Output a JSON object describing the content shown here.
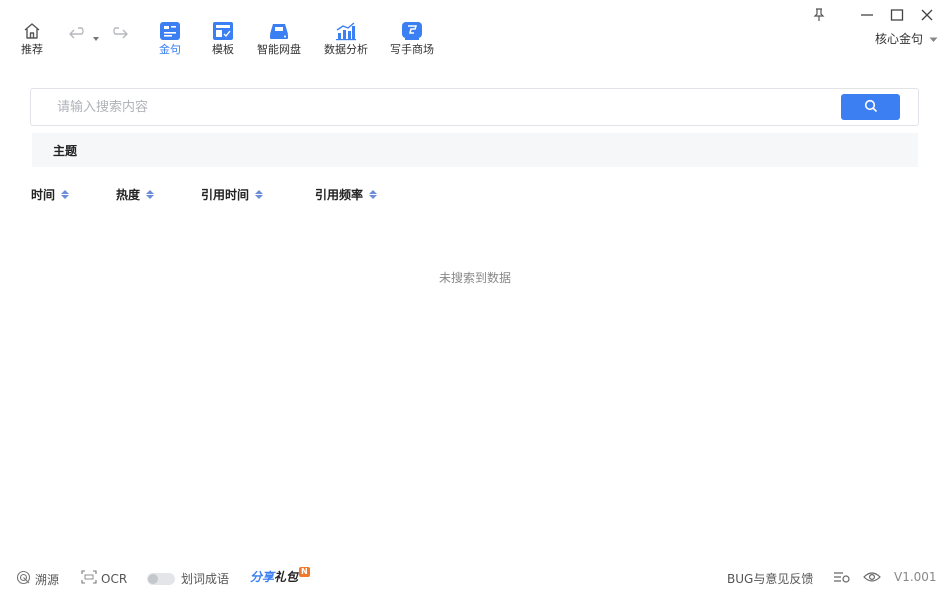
{
  "toolbar": {
    "nav": [
      {
        "label": "推荐",
        "icon": "home-icon",
        "active": false
      },
      {
        "label": "金句",
        "icon": "quote-card-icon",
        "active": true
      },
      {
        "label": "模板",
        "icon": "template-icon",
        "active": false
      },
      {
        "label": "智能网盘",
        "icon": "cloud-disk-icon",
        "active": false
      },
      {
        "label": "数据分析",
        "icon": "chart-icon",
        "active": false
      },
      {
        "label": "写手商场",
        "icon": "writer-mall-icon",
        "active": false
      }
    ],
    "product_select": "核心金句"
  },
  "search": {
    "placeholder": "请输入搜索内容",
    "value": ""
  },
  "topic_tabs": [
    "主题"
  ],
  "sort": {
    "items": [
      "时间",
      "热度",
      "引用时间",
      "引用频率"
    ]
  },
  "empty_message": "未搜索到数据",
  "bottom_bar": {
    "source": "溯源",
    "ocr": "OCR",
    "idiom_toggle": "划词成语",
    "gift_part1": "分享",
    "gift_part2": "礼包",
    "gift_badge": "N",
    "feedback": "BUG与意见反馈",
    "version": "V1.001"
  },
  "colors": {
    "accent": "#3b7ff2",
    "badge": "#f07a2a"
  }
}
